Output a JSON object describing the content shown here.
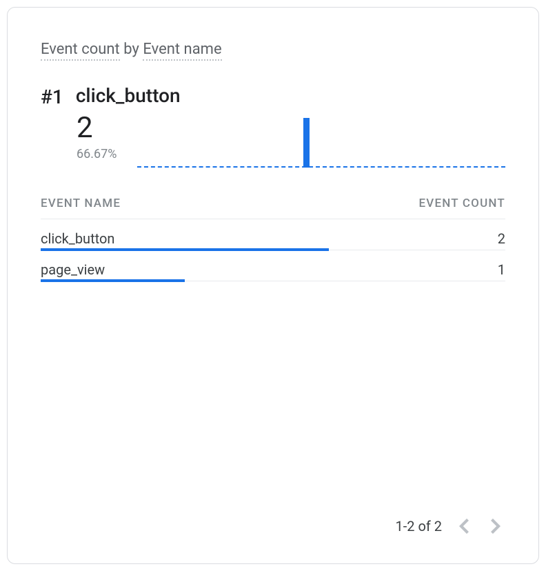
{
  "title": {
    "metric": "Event count",
    "by": "by",
    "dimension": "Event name"
  },
  "highlight": {
    "rank": "#1",
    "name": "click_button",
    "value": "2",
    "percent": "66.67%"
  },
  "table": {
    "header_name": "EVENT NAME",
    "header_count": "EVENT COUNT",
    "rows": [
      {
        "name": "click_button",
        "count": "2",
        "bar_pct": 62
      },
      {
        "name": "page_view",
        "count": "1",
        "bar_pct": 31
      }
    ]
  },
  "pager": {
    "label": "1-2 of 2"
  },
  "chart_data": {
    "type": "bar",
    "title": "Event count by Event name",
    "xlabel": "Event name",
    "ylabel": "Event count",
    "categories": [
      "click_button",
      "page_view"
    ],
    "values": [
      2,
      1
    ],
    "highlight": {
      "label": "click_button",
      "value": 2,
      "percent": 66.67
    },
    "sparkline": {
      "type": "bar",
      "values": [
        2
      ],
      "baseline": 0
    }
  }
}
